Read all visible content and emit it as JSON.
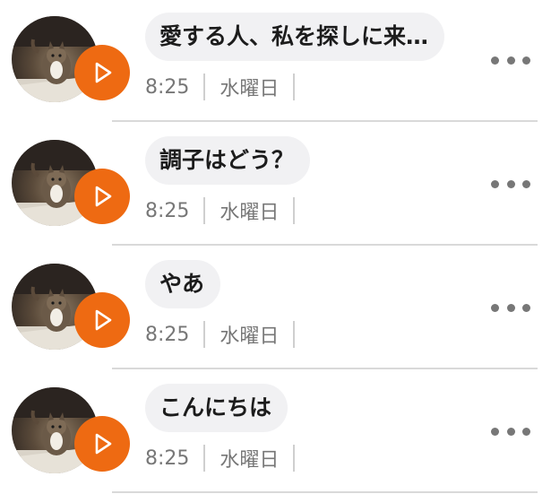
{
  "messages": [
    {
      "text": "愛する人、私を探しに来…",
      "time": "8:25",
      "day": "水曜日"
    },
    {
      "text": "調子はどう？",
      "time": "8:25",
      "day": "水曜日"
    },
    {
      "text": "やあ",
      "time": "8:25",
      "day": "水曜日"
    },
    {
      "text": "こんにちは",
      "time": "8:25",
      "day": "水曜日"
    }
  ],
  "colors": {
    "accent": "#ee6a12",
    "bubble": "#f1f1f3",
    "meta_text": "#777777",
    "divider": "#d9d9d9"
  },
  "icons": {
    "avatar": "cat-photo-avatar",
    "play": "play-icon",
    "more": "more-options-icon"
  }
}
